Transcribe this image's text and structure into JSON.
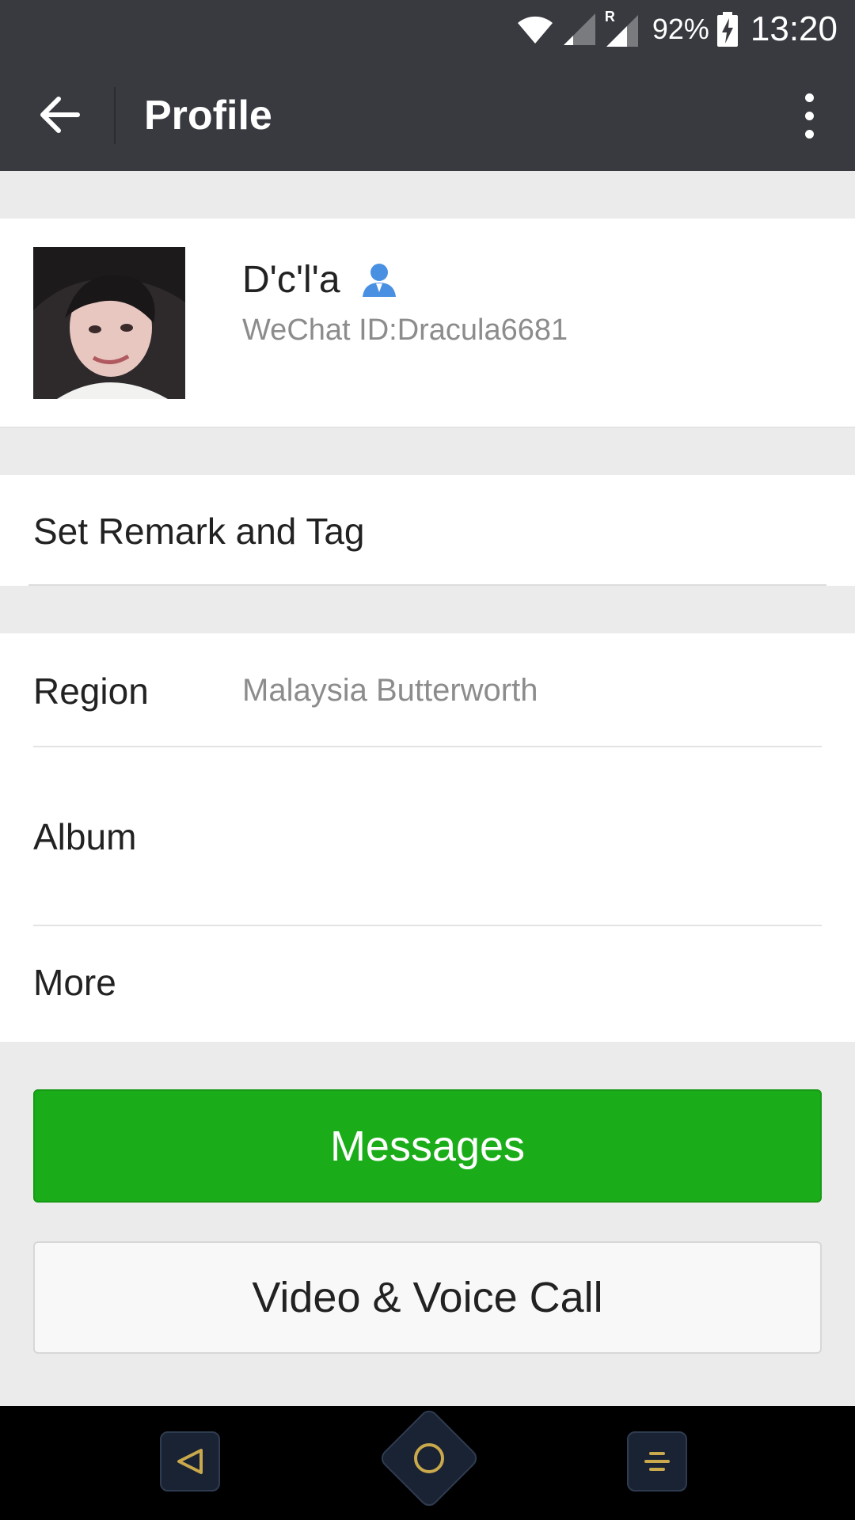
{
  "status_bar": {
    "battery_percent": "92%",
    "time": "13:20",
    "roaming_indicator": "R",
    "icons": [
      "wifi-icon",
      "signal-icon",
      "signal-roaming-icon",
      "battery-charging-icon"
    ]
  },
  "header": {
    "title": "Profile",
    "back_icon": "arrow-left-icon",
    "menu_icon": "more-vertical-icon"
  },
  "profile": {
    "name": "D'c'l'a",
    "wechat_id": "WeChat ID:Dracula6681",
    "contact_icon": "person-icon",
    "contact_icon_color": "#4a90e2"
  },
  "rows": {
    "remark_label": "Set Remark and Tag",
    "region_label": "Region",
    "region_value": "Malaysia  Butterworth",
    "album_label": "Album",
    "more_label": "More"
  },
  "buttons": {
    "messages_label": "Messages",
    "call_label": "Video & Voice Call"
  },
  "colors": {
    "header_bg": "#393a3f",
    "primary_green": "#1aad19",
    "page_bg": "#ebebeb",
    "nav_accent": "#c9a94b"
  },
  "nav_bar": {
    "icons": [
      "nav-back-icon",
      "nav-home-icon",
      "nav-recent-icon"
    ]
  }
}
